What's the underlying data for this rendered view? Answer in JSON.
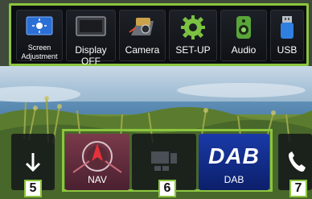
{
  "top_launcher": {
    "items": [
      {
        "label_line1": "Screen",
        "label_line2": "Adjustment",
        "icon": "brightness-icon"
      },
      {
        "label": "Display OFF",
        "icon": "display-off-icon"
      },
      {
        "label": "Camera",
        "icon": "camera-icon"
      },
      {
        "label": "SET-UP",
        "icon": "gear-icon"
      },
      {
        "label": "Audio",
        "icon": "speaker-icon"
      },
      {
        "label": "USB",
        "icon": "usb-icon"
      }
    ],
    "accent_color": "#8bc53f"
  },
  "bottom_bar": {
    "down_button_icon": "arrow-down-icon",
    "phone_button_icon": "phone-icon",
    "shortcuts": [
      {
        "label": "NAV",
        "icon": "nav-compass-icon"
      },
      {
        "label": "",
        "icon": "empty-slot-icon"
      },
      {
        "label": "DAB",
        "logo_text": "DAB",
        "icon": "dab-logo-icon"
      }
    ]
  },
  "callouts": {
    "down": "5",
    "shortcuts": "6",
    "phone": "7"
  }
}
